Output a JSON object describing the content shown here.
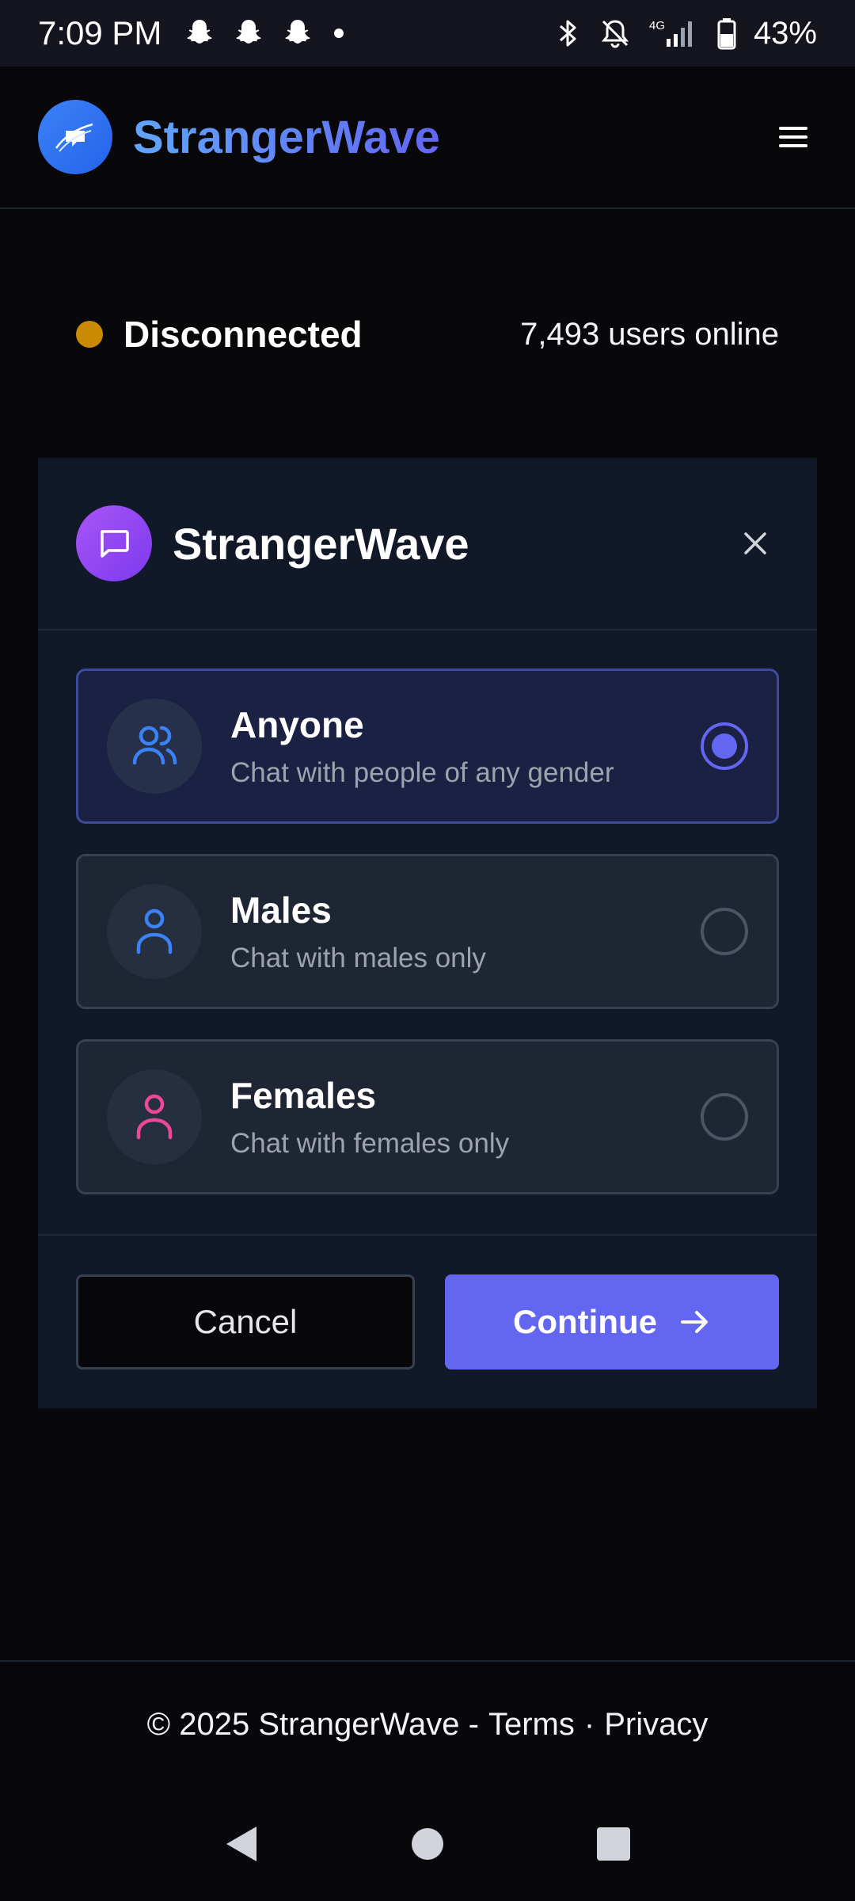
{
  "status_bar": {
    "time": "7:09 PM",
    "battery": "43%",
    "network": "4G"
  },
  "header": {
    "brand": "StrangerWave"
  },
  "connection": {
    "status": "Disconnected",
    "users_online": "7,493 users online",
    "status_color": "#ca8a04"
  },
  "modal": {
    "title": "StrangerWave",
    "options": [
      {
        "title": "Anyone",
        "subtitle": "Chat with people of any gender",
        "selected": true,
        "icon": "users-icon"
      },
      {
        "title": "Males",
        "subtitle": "Chat with males only",
        "selected": false,
        "icon": "male-user-icon"
      },
      {
        "title": "Females",
        "subtitle": "Chat with females only",
        "selected": false,
        "icon": "female-user-icon"
      }
    ],
    "cancel_label": "Cancel",
    "continue_label": "Continue"
  },
  "footer": {
    "copyright": "© 2025 StrangerWave -",
    "terms": "Terms",
    "separator": "·",
    "privacy": "Privacy"
  },
  "colors": {
    "accent": "#6366f1",
    "male": "#3b82f6",
    "female": "#ec4899"
  }
}
